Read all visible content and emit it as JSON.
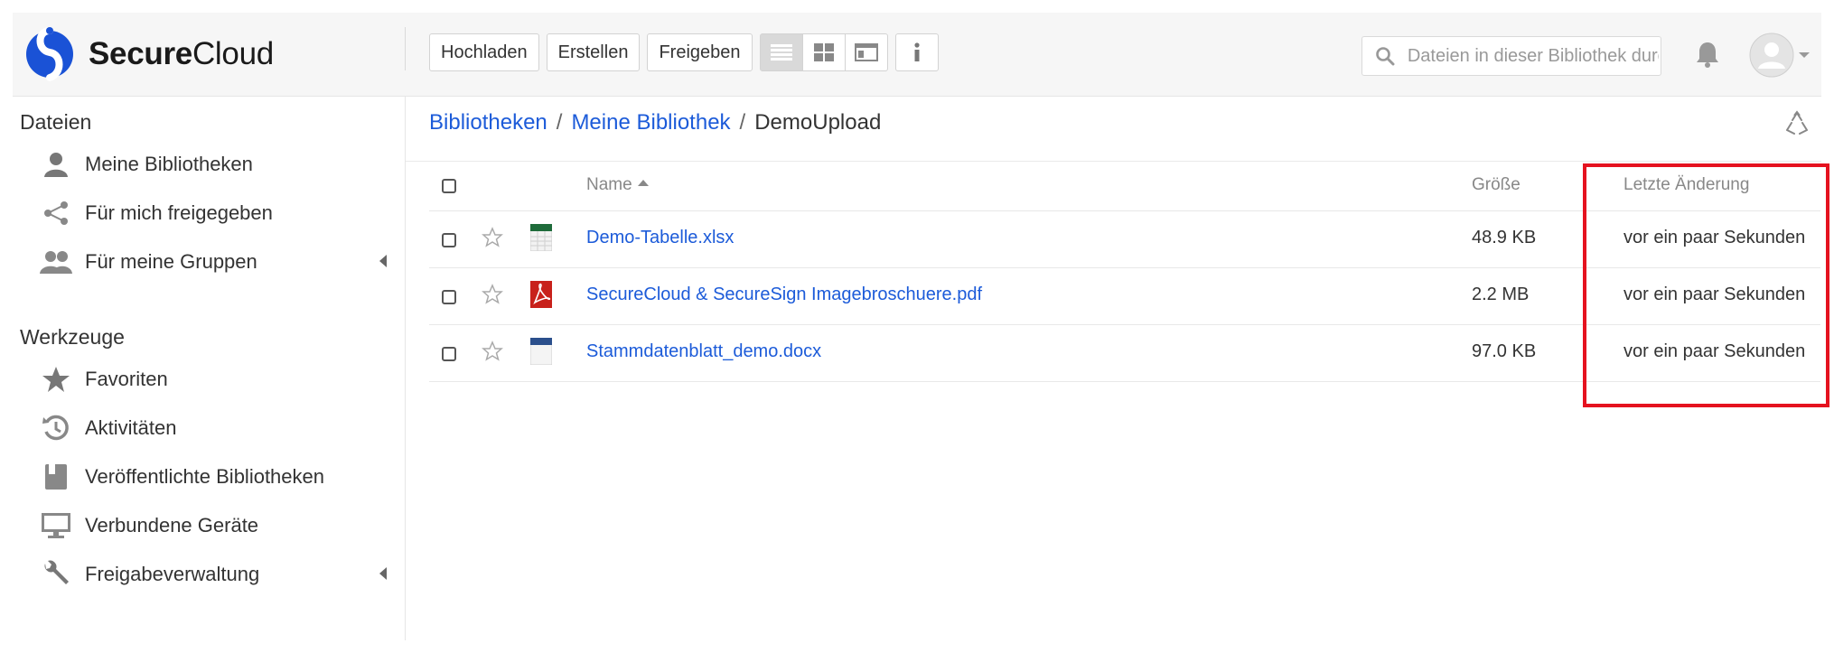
{
  "brand": {
    "bold": "Secure",
    "regular": "Cloud"
  },
  "toolbar": {
    "upload": "Hochladen",
    "create": "Erstellen",
    "share": "Freigeben"
  },
  "search": {
    "placeholder": "Dateien in dieser Bibliothek durchsuchen"
  },
  "sidebar": {
    "files_heading": "Dateien",
    "tools_heading": "Werkzeuge",
    "items": [
      {
        "label": "Meine Bibliotheken",
        "icon": "user-icon"
      },
      {
        "label": "Für mich freigegeben",
        "icon": "share-icon"
      },
      {
        "label": "Für meine Gruppen",
        "icon": "group-icon"
      },
      {
        "label": "Favoriten",
        "icon": "star-icon"
      },
      {
        "label": "Aktivitäten",
        "icon": "history-icon"
      },
      {
        "label": "Veröffentlichte Bibliotheken",
        "icon": "book-icon"
      },
      {
        "label": "Verbundene Geräte",
        "icon": "monitor-icon"
      },
      {
        "label": "Freigabeverwaltung",
        "icon": "wrench-icon"
      }
    ]
  },
  "breadcrumb": {
    "root": "Bibliotheken",
    "library": "Meine Bibliothek",
    "current": "DemoUpload"
  },
  "table": {
    "headers": {
      "name": "Name",
      "size": "Größe",
      "modified": "Letzte Änderung"
    },
    "rows": [
      {
        "name": "Demo-Tabelle.xlsx",
        "size": "48.9 KB",
        "modified": "vor ein paar Sekunden",
        "type": "xlsx"
      },
      {
        "name": "SecureCloud & SecureSign Imagebroschuere.pdf",
        "size": "2.2 MB",
        "modified": "vor ein paar Sekunden",
        "type": "pdf"
      },
      {
        "name": "Stammdatenblatt_demo.docx",
        "size": "97.0 KB",
        "modified": "vor ein paar Sekunden",
        "type": "docx"
      }
    ]
  },
  "colors": {
    "link": "#1c5bd9",
    "brand_blue": "#1a52d6",
    "highlight": "#e5121f",
    "xlsx": "#1e6b3a",
    "pdf": "#c8211b",
    "docx": "#2b4f8c"
  }
}
